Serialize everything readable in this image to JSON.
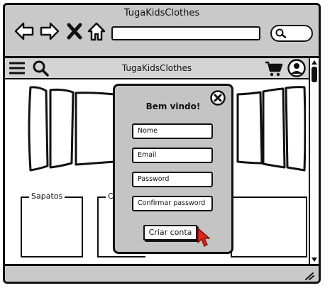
{
  "browser": {
    "title": "TugaKidsClothes",
    "icons": [
      "back-arrow-icon",
      "forward-arrow-icon",
      "close-x-icon",
      "home-icon",
      "search-icon"
    ]
  },
  "app": {
    "title": "TugaKidsClothes",
    "icons": [
      "hamburger-menu-icon",
      "search-icon",
      "cart-icon",
      "user-icon"
    ]
  },
  "categories": [
    {
      "label": "Sapatos"
    },
    {
      "label": "C"
    }
  ],
  "modal": {
    "heading": "Bem vindo!",
    "fields": [
      {
        "placeholder": "Nome"
      },
      {
        "placeholder": "Email"
      },
      {
        "placeholder": "Password"
      },
      {
        "placeholder": "Confirmar password"
      }
    ],
    "submit_label": "Criar conta"
  },
  "colors": {
    "chrome": "#c9c9c9",
    "modal_bg": "#c4c4c4",
    "cursor": "#e0261b",
    "ink": "#111111"
  }
}
